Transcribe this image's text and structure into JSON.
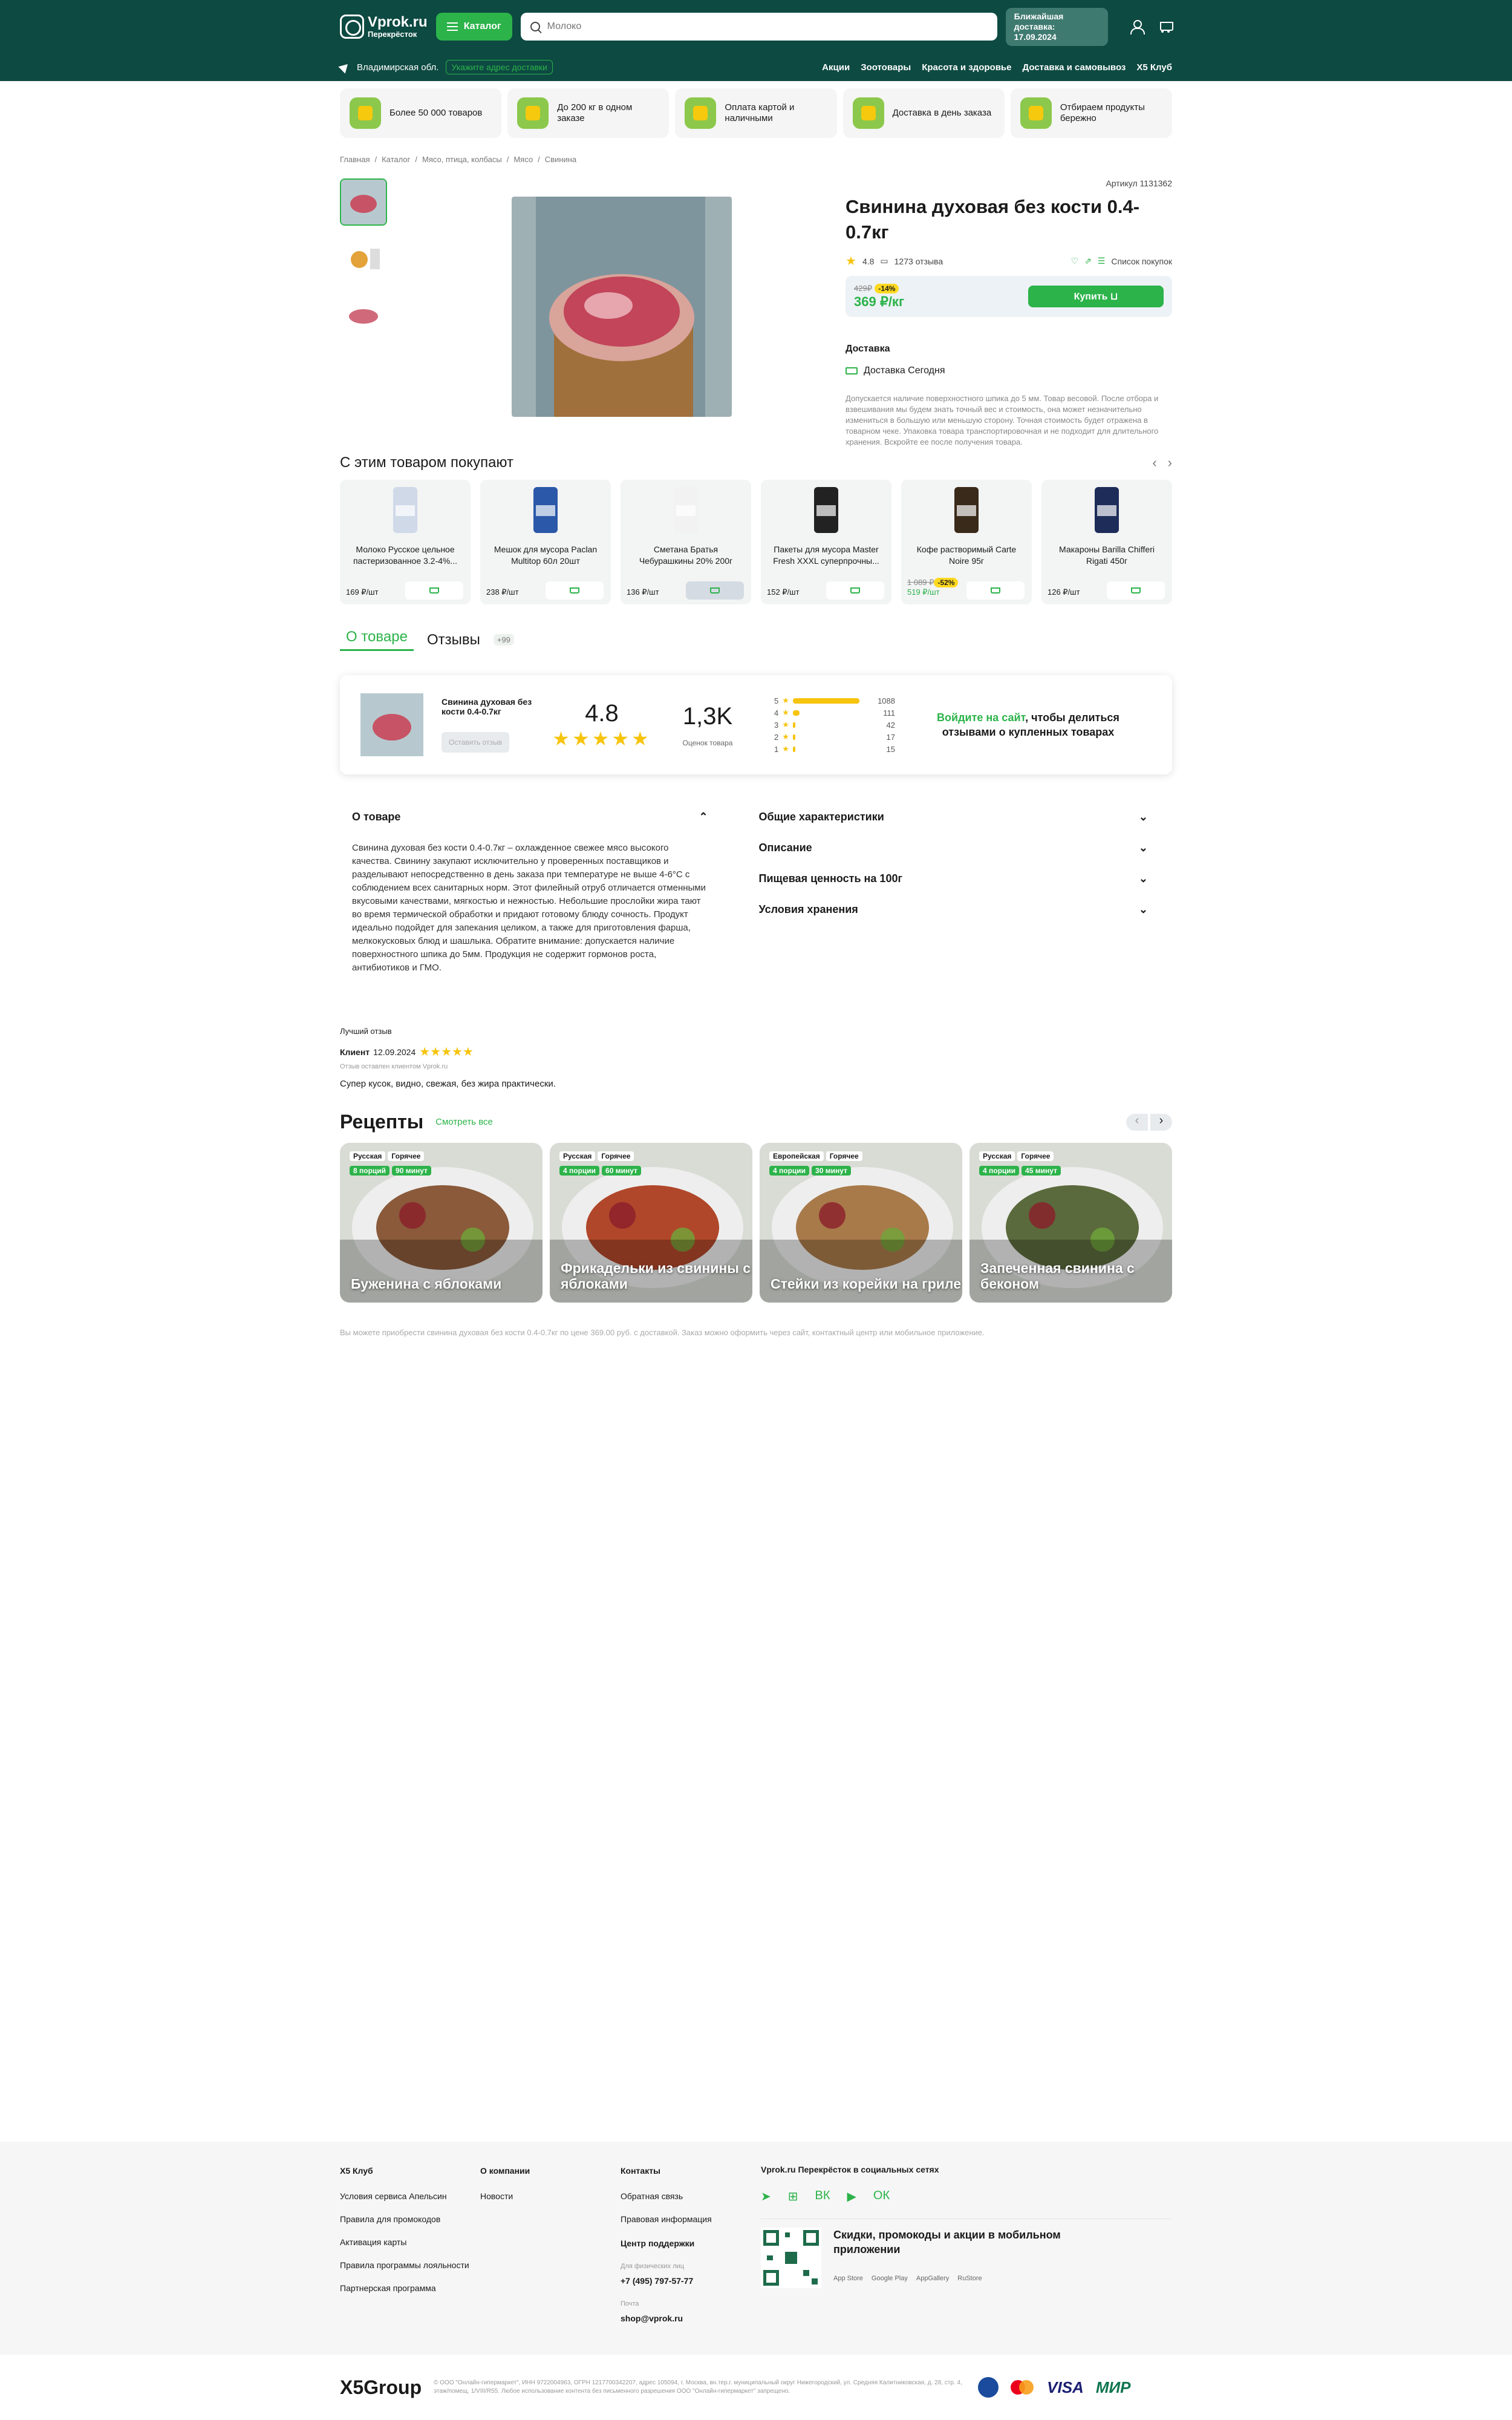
{
  "header": {
    "logo_title": "Vprok.ru",
    "logo_sub": "Перекрёсток",
    "catalog": "Каталог",
    "search_placeholder": "Молоко",
    "delivery_title": "Ближайшая доставка:",
    "delivery_date": "17.09.2024",
    "region": "Владимирская обл.",
    "address_btn": "Укажите адрес доставки",
    "nav": [
      "Акции",
      "Зоотовары",
      "Красота и здоровье",
      "Доставка и самовывоз",
      "X5 Клуб"
    ]
  },
  "features": [
    "Более 50 000 товаров",
    "До 200 кг в одном заказе",
    "Оплата картой и наличными",
    "Доставка в день заказа",
    "Отбираем продукты бережно"
  ],
  "breadcrumbs": [
    "Главная",
    "/",
    "Каталог",
    "/",
    "Мясо, птица, колбасы",
    "/",
    "Мясо",
    "/",
    "Свинина"
  ],
  "product": {
    "article": "Артикул 1131362",
    "title": "Свинина духовая без кости 0.4-0.7кг",
    "rating": "4.8",
    "reviews": "1273 отзыва",
    "shopping_list": "Список покупок",
    "old_price": "429₽",
    "discount": "-14%",
    "price": "369 ₽/кг",
    "buy": "Купить",
    "delivery_label": "Доставка",
    "delivery_today": "Доставка Сегодня",
    "note": "Допускается наличие поверхностного шпика до 5 мм. Товар весовой. После отбора и взвешивания мы будем знать точный вес и стоимость, она может незначительно измениться в большую или меньшую сторону. Точная стоимость будет отражена в товарном чеке. Упаковка товара транспортировочная и не подходит для длительного хранения. Вскройте ее после получения товара."
  },
  "related": {
    "title": "С этим товаром покупают",
    "items": [
      {
        "name": "Молоко Русское цельное пастеризованное 3.2-4%...",
        "price": "169 ₽/шт"
      },
      {
        "name": "Мешок для мусора Paclan Multitop 60л 20шт",
        "price": "238 ₽/шт"
      },
      {
        "name": "Сметана Братья Чебурашкины 20% 200г",
        "price": "136 ₽/шт"
      },
      {
        "name": "Пакеты для мусора Master Fresh XXXL суперпрочны...",
        "price": "152 ₽/шт"
      },
      {
        "name": "Кофе растворимый Carte Noire 95г",
        "old": "1 089 ₽",
        "disc": "-52%",
        "price": "519 ₽/шт"
      },
      {
        "name": "Макароны Barilla Chifferi Rigati 450г",
        "price": "126 ₽/шт"
      }
    ]
  },
  "tabs": {
    "about": "О товаре",
    "reviews": "Отзывы",
    "count": "+99"
  },
  "review_box": {
    "name": "Свинина духовая без кости 0.4-0.7кг",
    "leave": "Оставить отзыв",
    "rating": "4.8",
    "count": "1,3K",
    "count_label": "Оценок товара",
    "dist": [
      {
        "n": "5",
        "c": "1088",
        "f": 1
      },
      {
        "n": "4",
        "c": "111",
        "f": 0.1
      },
      {
        "n": "3",
        "c": "42",
        "f": 0.04
      },
      {
        "n": "2",
        "c": "17",
        "f": 0.02
      },
      {
        "n": "1",
        "c": "15",
        "f": 0.015
      }
    ],
    "login": "Войдите на сайт",
    "login_rest": ", чтобы делиться отзывами о купленных товарах"
  },
  "about": {
    "title": "О товаре",
    "text": "Свинина духовая без кости 0.4-0.7кг – охлажденное свежее мясо высокого качества. Свинину закупают исключительно у проверенных поставщиков и разделывают непосредственно в день заказа при температуре не выше 4-6°C с соблюдением всех санитарных норм. Этот филейный отруб отличается отменными вкусовыми качествами, мягкостью и нежностью. Небольшие прослойки жира тают во время термической обработки и придают готовому блюду сочность. Продукт идеально подойдет для запекания целиком, а также для приготовления фарша, мелкокусковых блюд и шашлыка. Обратите внимание: допускается наличие поверхностного шпика до 5мм. Продукция не содержит гормонов роста, антибиотиков и ГМО.",
    "sections": [
      "Общие характеристики",
      "Описание",
      "Пищевая ценность на 100г",
      "Условия хранения"
    ]
  },
  "best_review": {
    "label": "Лучший отзыв",
    "author": "Клиент",
    "date": "12.09.2024",
    "source": "Отзыв оставлен клиентом Vprok.ru",
    "text": "Супер кусок, видно, свежая, без жира практически."
  },
  "recipes": {
    "title": "Рецепты",
    "all": "Смотреть все",
    "items": [
      {
        "t1": "Русская",
        "t2": "Горячее",
        "p": "8 порций",
        "m": "90 минут",
        "name": "Буженина с яблоками",
        "c": "#8a5a3a"
      },
      {
        "t1": "Русская",
        "t2": "Горячее",
        "p": "4 порции",
        "m": "60 минут",
        "name": "Фрикадельки из свинины с яблоками",
        "c": "#b0472a"
      },
      {
        "t1": "Европейская",
        "t2": "Горячее",
        "p": "4 порции",
        "m": "30 минут",
        "name": "Стейки из корейки на гриле",
        "c": "#a87a4a"
      },
      {
        "t1": "Русская",
        "t2": "Горячее",
        "p": "4 порции",
        "m": "45 минут",
        "name": "Запеченная свинина с беконом",
        "c": "#5b6a3c"
      }
    ]
  },
  "seo": "Вы можете приобрести свинина духовая без кости 0.4-0.7кг по цене 369.00 руб. с доставкой. Заказ можно оформить через сайт, контактный центр или мобильное приложение.",
  "footer": {
    "c1": {
      "t": "X5 Клуб",
      "i": [
        "Условия сервиса Апельсин",
        "Правила для промокодов",
        "Активация карты",
        "Правила программы лояльности",
        "Партнерская программа"
      ]
    },
    "c2": {
      "t": "О компании",
      "i": [
        "Новости"
      ]
    },
    "c3": {
      "t": "Контакты",
      "i": [
        "Обратная связь",
        "Правовая информация"
      ]
    },
    "support": "Центр поддержки",
    "phone_label": "Для физических лиц",
    "phone": "+7 (495) 797-57-77",
    "mail_label": "Почта",
    "mail": "shop@vprok.ru",
    "social": "Vprok.ru Перекрёсток в социальных сетях",
    "app": "Скидки, промокоды и акции в мобильном приложении",
    "stores": [
      "App Store",
      "Google Play",
      "AppGallery",
      "RuStore"
    ],
    "x5": "X5Group",
    "legal": "© ООО \"Онлайн-гипермаркет\", ИНН 9722004963, ОГРН 1217700342207, адрес 105094, г. Москва, вн.тер.г. муниципальный округ Нижегородский, ул. Средняя Калитниковская, д. 28, стр. 4, этаж/помещ. 1/VIII/R55. Любое использование контента без письменного разрешения ООО \"Онлайн-гипермаркет\" запрещено.",
    "pays": [
      "VISA",
      "МИР"
    ]
  }
}
